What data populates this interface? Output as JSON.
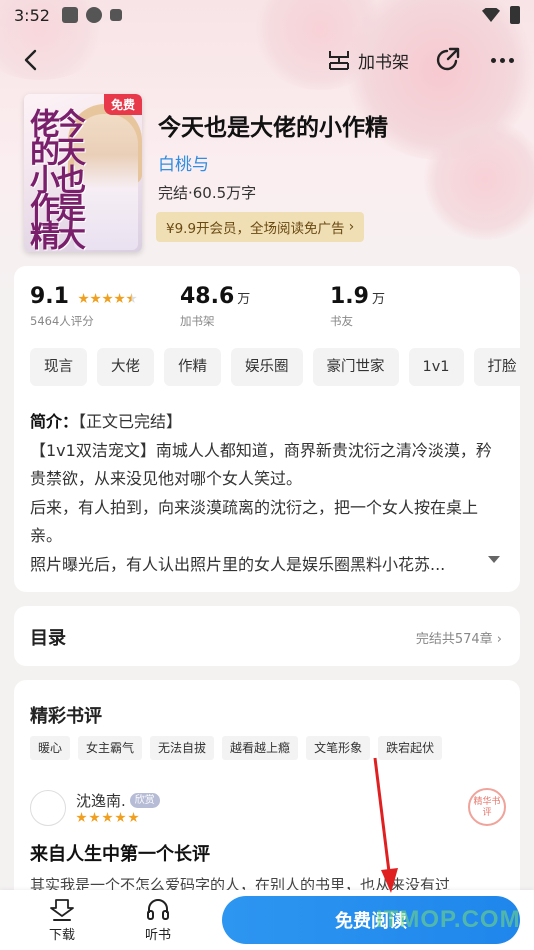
{
  "status_bar": {
    "time": "3:52"
  },
  "topbar": {
    "add_shelf_label": "加书架"
  },
  "book": {
    "cover_badge": "免费",
    "cover_title_art": "今天也是大佬的小作精",
    "title": "今天也是大佬的小作精",
    "author": "白桃与",
    "meta": "完结·60.5万字",
    "vip_promo": "¥9.9开会员，全场阅读免广告",
    "vip_arrow": "›"
  },
  "stats": [
    {
      "value": "9.1",
      "unit": "",
      "label": "5464人评分",
      "rating_stars": 4.5
    },
    {
      "value": "48.6",
      "unit": "万",
      "label": "加书架"
    },
    {
      "value": "1.9",
      "unit": "万",
      "label": "书友"
    }
  ],
  "tags": [
    "现言",
    "大佬",
    "作精",
    "娱乐圈",
    "豪门世家",
    "1v1",
    "打脸"
  ],
  "intro": {
    "label": "简介：",
    "line1": "【正文已完结】",
    "line2": "【1v1双洁宠文】南城人人都知道，商界新贵沈衍之清冷淡漠，矜贵禁欲，从来没见他对哪个女人笑过。",
    "line3": "后来，有人拍到，向来淡漠疏离的沈衍之，把一个女人按在桌上亲。",
    "line4": "照片曝光后，有人认出照片里的女人是娱乐圈黑料小花苏..."
  },
  "toc": {
    "title": "目录",
    "summary": "完结共574章 ›"
  },
  "reviews": {
    "title": "精彩书评",
    "tags": [
      "暖心",
      "女主霸气",
      "无法自拔",
      "越看越上瘾",
      "文笔形象",
      "跌宕起伏"
    ],
    "item": {
      "user": "沈逸南.",
      "badge": "欣赏",
      "stars": 5,
      "seal": "精华书评",
      "headline": "来自人生中第一个长评",
      "body": "其实我是一个不怎么爱码字的人，在别人的书里，也从来没有过"
    }
  },
  "bottom_bar": {
    "download": "下载",
    "listen": "听书",
    "read": "免费阅读"
  },
  "watermark": "ITMOP.COM",
  "colors": {
    "accent": "#1f86ec",
    "author": "#2f8de4",
    "star": "#f0a020",
    "badge": "#e8394b"
  }
}
